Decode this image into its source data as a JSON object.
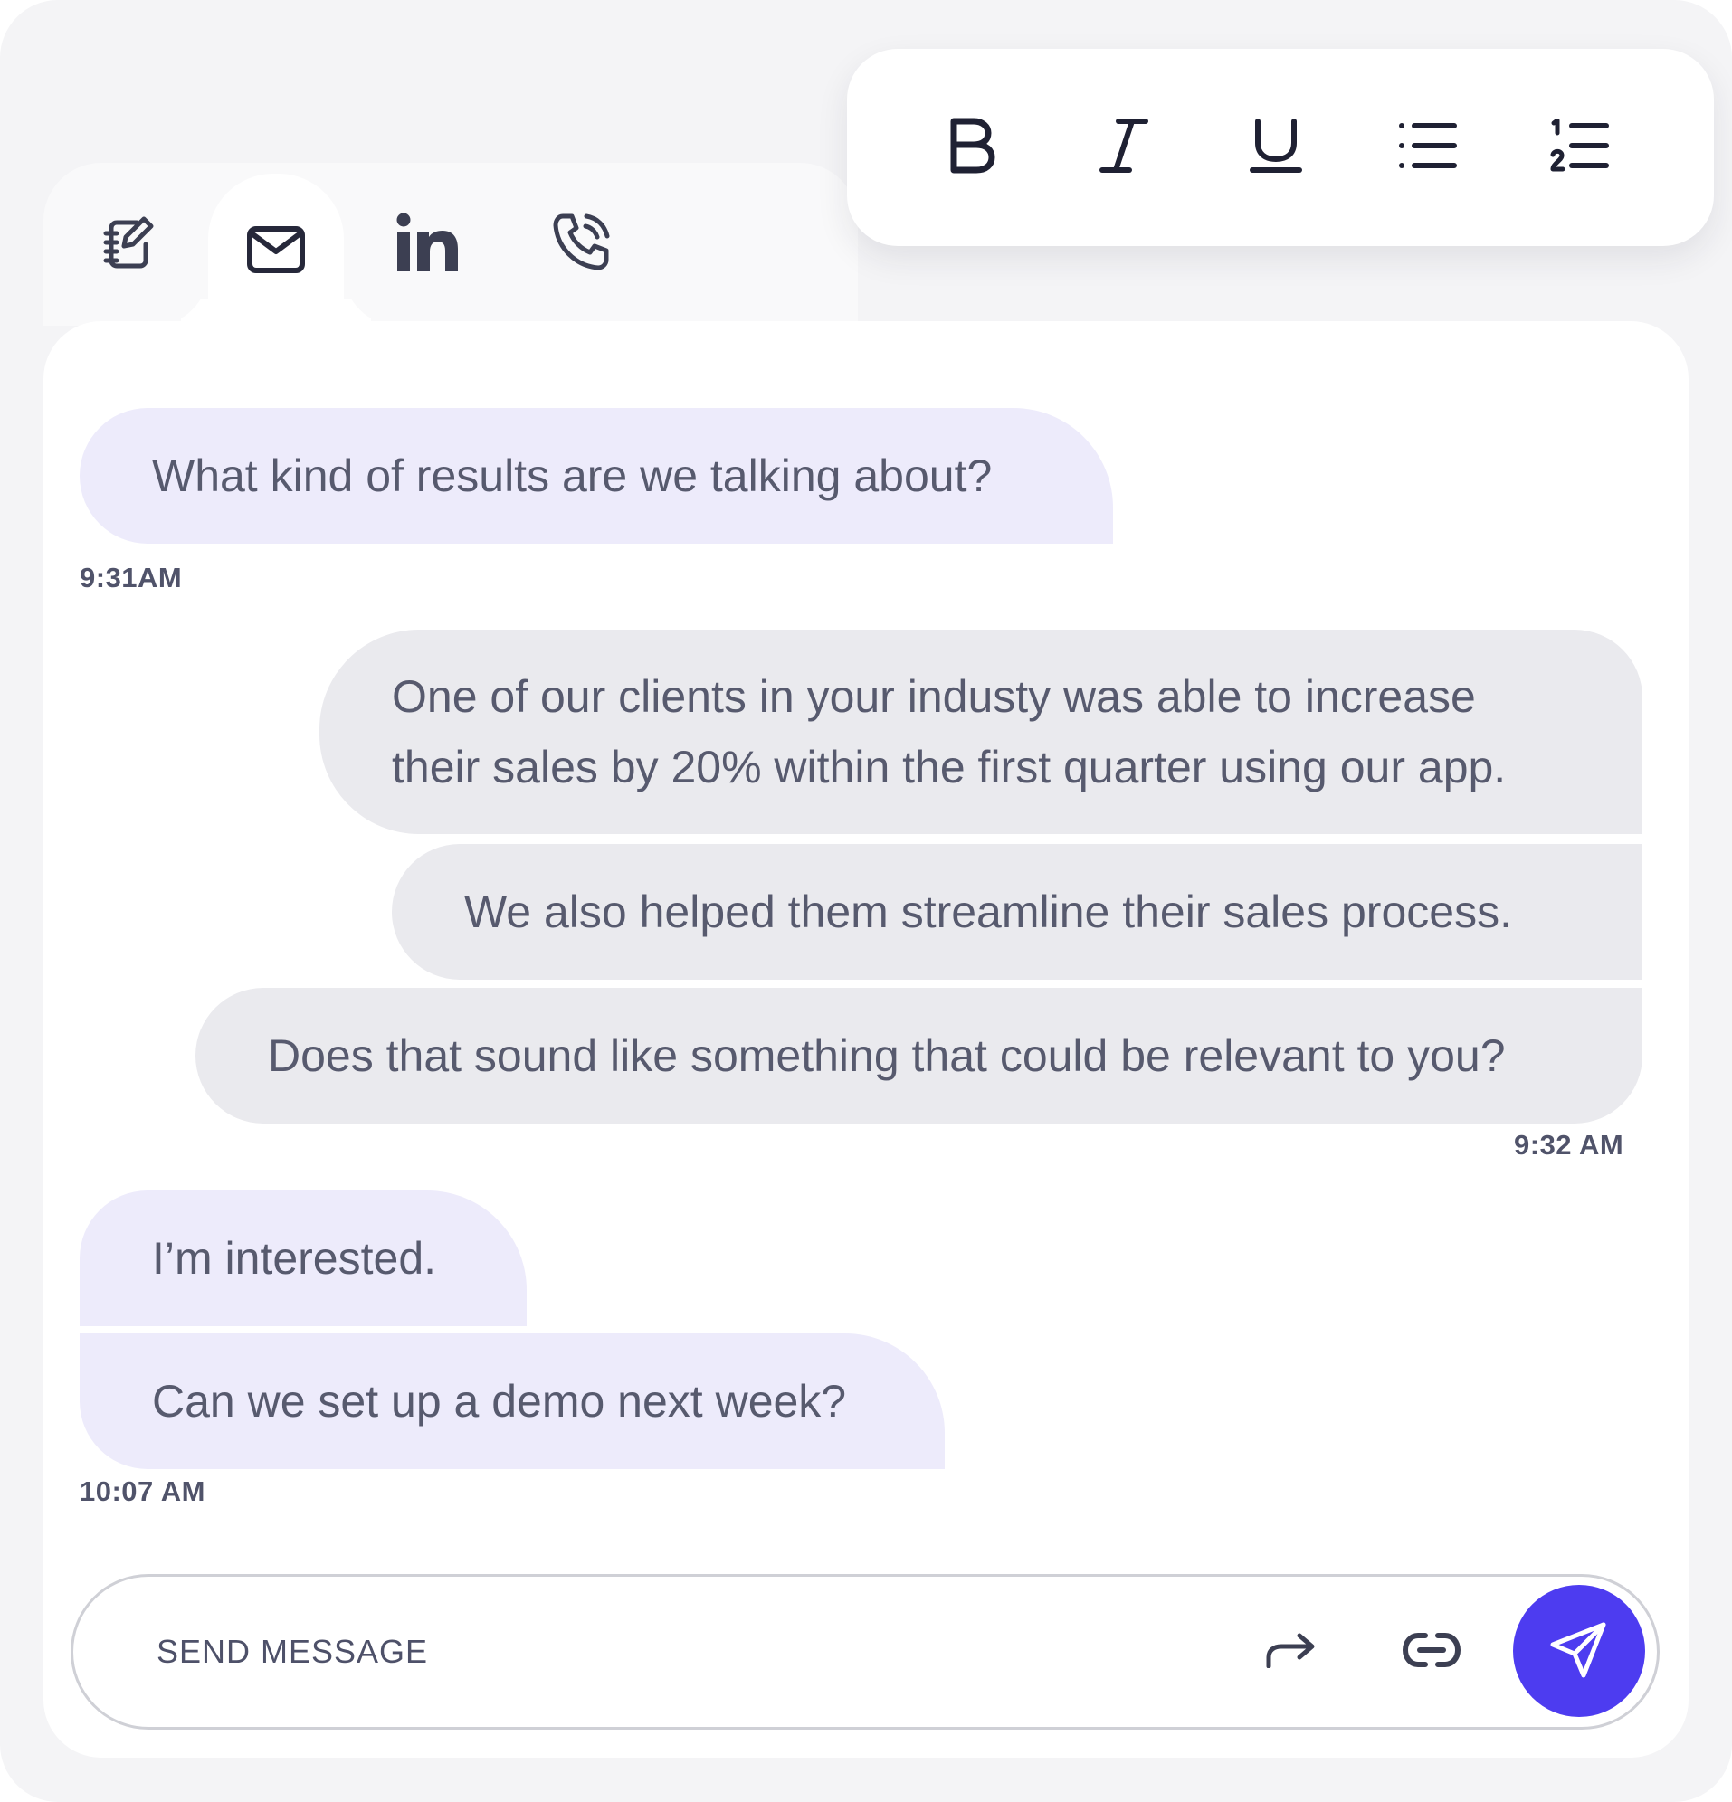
{
  "tabs": [
    {
      "icon": "notes-icon",
      "active": false
    },
    {
      "icon": "mail-icon",
      "active": true
    },
    {
      "icon": "linkedin-icon",
      "active": false
    },
    {
      "icon": "phone-call-icon",
      "active": false
    }
  ],
  "toolbar": {
    "tools": [
      "bold-icon",
      "italic-icon",
      "underline-icon",
      "bulleted-list-icon",
      "numbered-list-icon"
    ]
  },
  "messages": [
    {
      "direction": "incoming",
      "text": "What kind of results are we talking about?"
    },
    {
      "direction": "incoming",
      "time": "9:31AM"
    },
    {
      "direction": "outgoing",
      "lines": [
        "One of our clients in your industy was able to increase",
        "their sales by 20% within the first quarter using our app."
      ]
    },
    {
      "direction": "outgoing",
      "text": "We also helped them streamline their sales process."
    },
    {
      "direction": "outgoing",
      "text": "Does that sound like something that could be relevant to you?"
    },
    {
      "direction": "outgoing",
      "time": "9:32 AM"
    },
    {
      "direction": "incoming",
      "text": "I’m interested."
    },
    {
      "direction": "incoming",
      "text": "Can we set up a demo next week?"
    },
    {
      "direction": "incoming",
      "time": "10:07 AM"
    }
  ],
  "composer": {
    "placeholder": "SEND MESSAGE",
    "icons": [
      "forward-icon",
      "link-icon",
      "send-icon"
    ]
  },
  "colors": {
    "accent": "#4d3cf0",
    "incoming_bubble": "#edebfb",
    "outgoing_bubble": "#eaeaee",
    "text": "#575a6e",
    "icon": "#3a3d50"
  }
}
